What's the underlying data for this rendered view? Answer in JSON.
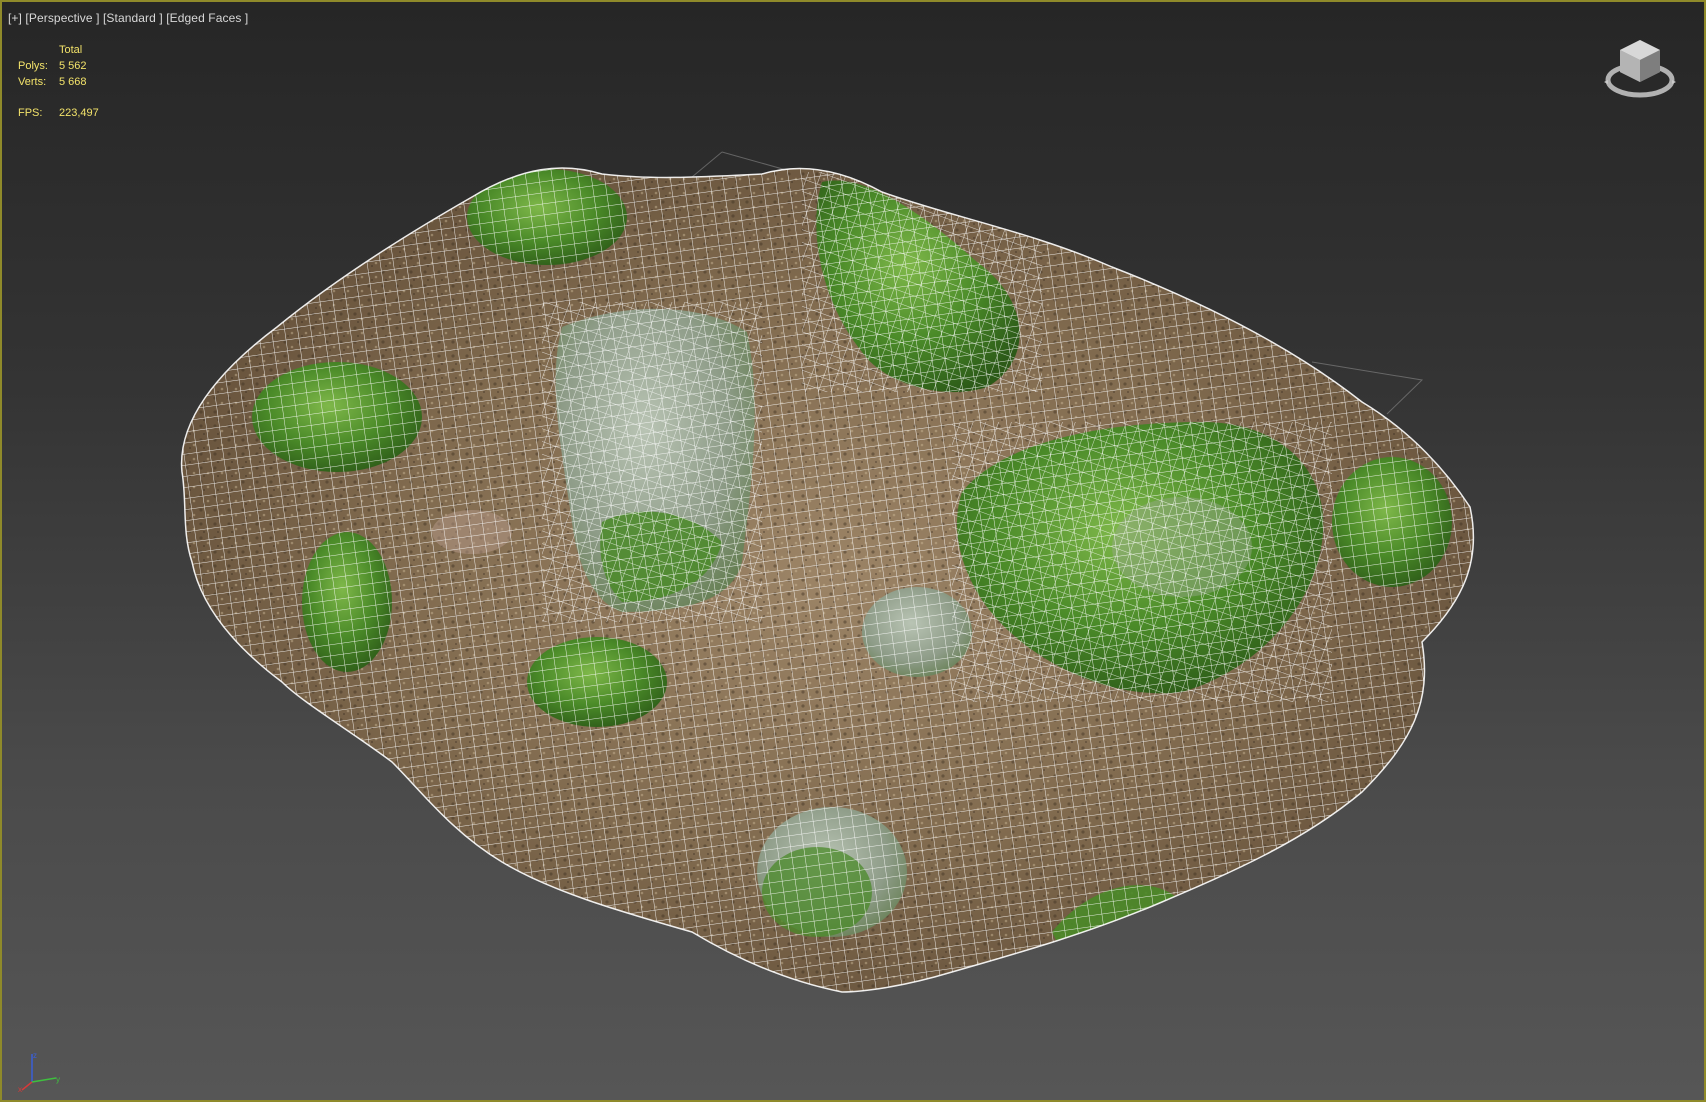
{
  "viewport": {
    "label_parts": [
      "[+]",
      "[Perspective ]",
      "[Standard ]",
      "[Edged Faces ]"
    ],
    "border_color": "#8f8a2a"
  },
  "stats": {
    "header": "Total",
    "rows": [
      {
        "label": "Polys:",
        "value": "5 562"
      },
      {
        "label": "Verts:",
        "value": "5 668"
      }
    ],
    "fps_label": "FPS:",
    "fps_value": "223,497",
    "text_color": "#f3e36a"
  },
  "icons": {
    "viewcube": "viewcube-icon",
    "axis": "axis-tripod-icon"
  },
  "colors": {
    "ground": "#7d6a4f",
    "moss": "#4a8a2a",
    "wire": "#ffffff"
  }
}
